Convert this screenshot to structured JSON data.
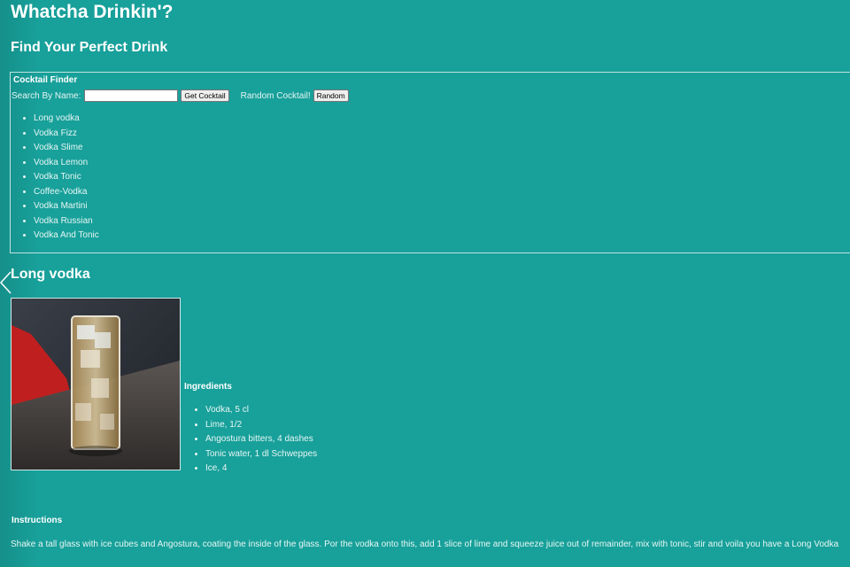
{
  "page": {
    "title": "Whatcha Drinkin'?",
    "subtitle": "Find Your Perfect Drink"
  },
  "finder": {
    "legend": "Cocktail Finder",
    "search_label": "Search By Name:",
    "search_value": "",
    "search_button": "Get Cocktail",
    "random_label": "Random Cocktail!",
    "random_button": "Random",
    "results": [
      "Long vodka",
      "Vodka Fizz",
      "Vodka Slime",
      "Vodka Lemon",
      "Vodka Tonic",
      "Coffee-Vodka",
      "Vodka Martini",
      "Vodka Russian",
      "Vodka And Tonic"
    ]
  },
  "drink": {
    "name": "Long vodka",
    "back_icon": "chevron-left-icon",
    "image": "tall-glass-photo",
    "ingredients_title": "Ingredients",
    "ingredients": [
      "Vodka, 5 cl",
      "Lime, 1/2",
      "Angostura bitters, 4 dashes",
      "Tonic water, 1 dl Schweppes",
      "Ice, 4"
    ],
    "instructions_title": "Instructions",
    "instructions": "Shake a tall glass with ice cubes and Angostura, coating the inside of the glass. Por the vodka onto this, add 1 slice of lime and squeeze juice out of remainder, mix with tonic, stir and voila you have a Long Vodka"
  },
  "colors": {
    "background": "#18a09a",
    "text": "#ffffff"
  }
}
